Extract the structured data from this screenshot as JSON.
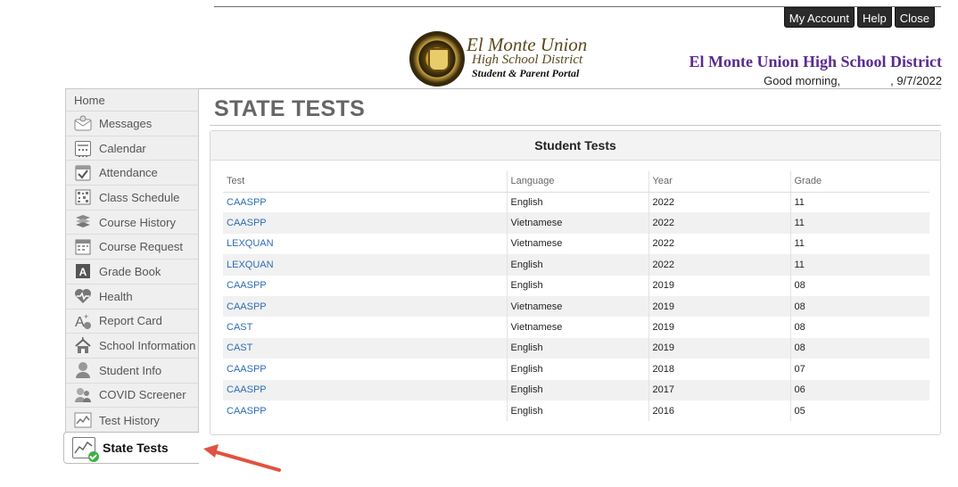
{
  "header": {
    "buttons": {
      "my_account": "My Account",
      "help": "Help",
      "close": "Close"
    },
    "logo": {
      "line1": "El Monte Union",
      "line2": "High School District",
      "line3": "Student & Parent Portal"
    },
    "district_name": "El Monte Union High School District",
    "greeting_prefix": "Good morning,",
    "greeting_date": ", 9/7/2022"
  },
  "sidebar": {
    "home": "Home",
    "items": [
      {
        "label": "Messages",
        "icon": "messages-icon"
      },
      {
        "label": "Calendar",
        "icon": "calendar-icon"
      },
      {
        "label": "Attendance",
        "icon": "attendance-icon"
      },
      {
        "label": "Class Schedule",
        "icon": "class-schedule-icon"
      },
      {
        "label": "Course History",
        "icon": "course-history-icon"
      },
      {
        "label": "Course Request",
        "icon": "course-request-icon"
      },
      {
        "label": "Grade Book",
        "icon": "grade-book-icon"
      },
      {
        "label": "Health",
        "icon": "health-icon"
      },
      {
        "label": "Report Card",
        "icon": "report-card-icon"
      },
      {
        "label": "School Information",
        "icon": "school-information-icon"
      },
      {
        "label": "Student Info",
        "icon": "student-info-icon"
      },
      {
        "label": "COVID Screener",
        "icon": "covid-screener-icon"
      },
      {
        "label": "Test History",
        "icon": "test-history-icon"
      }
    ],
    "active": {
      "label": "State Tests",
      "icon": "state-tests-icon"
    }
  },
  "main": {
    "title": "STATE TESTS",
    "panel_title": "Student Tests",
    "columns": [
      "Test",
      "Language",
      "Year",
      "Grade"
    ],
    "rows": [
      [
        "CAASPP",
        "English",
        "2022",
        "11"
      ],
      [
        "CAASPP",
        "Vietnamese",
        "2022",
        "11"
      ],
      [
        "LEXQUAN",
        "Vietnamese",
        "2022",
        "11"
      ],
      [
        "LEXQUAN",
        "English",
        "2022",
        "11"
      ],
      [
        "CAASPP",
        "English",
        "2019",
        "08"
      ],
      [
        "CAASPP",
        "Vietnamese",
        "2019",
        "08"
      ],
      [
        "CAST",
        "Vietnamese",
        "2019",
        "08"
      ],
      [
        "CAST",
        "English",
        "2019",
        "08"
      ],
      [
        "CAASPP",
        "English",
        "2018",
        "07"
      ],
      [
        "CAASPP",
        "English",
        "2017",
        "06"
      ],
      [
        "CAASPP",
        "English",
        "2016",
        "05"
      ]
    ]
  },
  "colors": {
    "district_purple": "#5b2b8e",
    "link_blue": "#2d6db5",
    "arrow_red": "#e0533f",
    "status_green": "#3cb043"
  }
}
